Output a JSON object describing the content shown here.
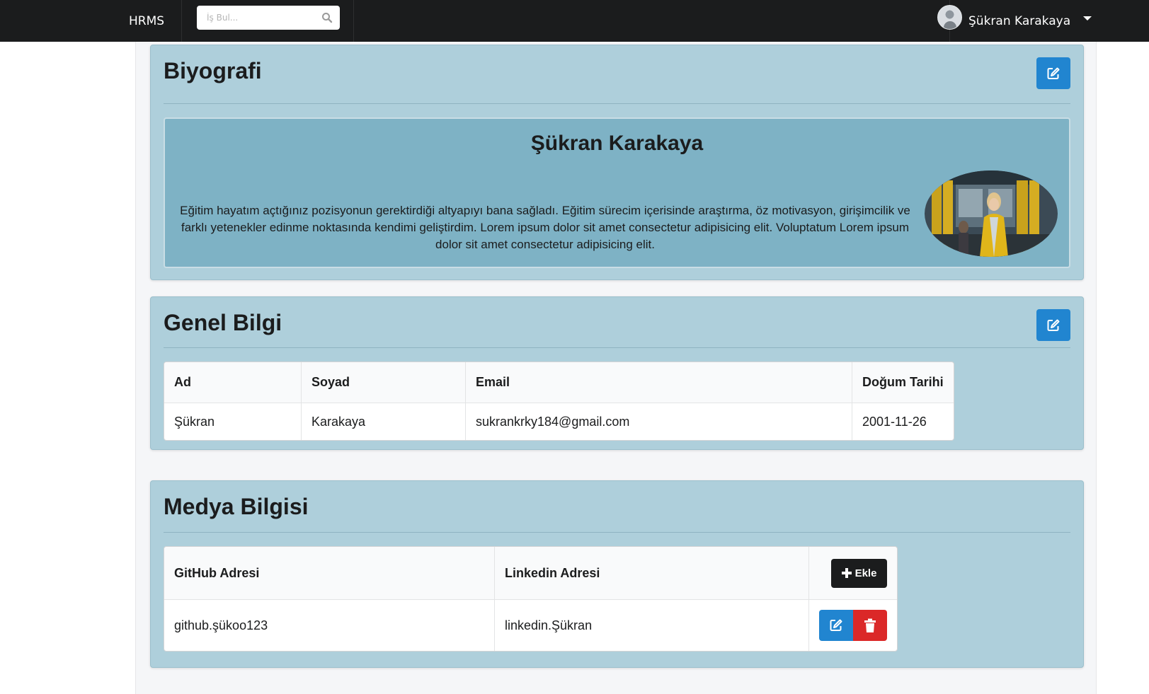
{
  "navbar": {
    "brand": "HRMS",
    "search_placeholder": "İş Bul...",
    "user_name": "Şükran Karakaya"
  },
  "biography": {
    "title": "Biyografi",
    "name": "Şükran Karakaya",
    "text": "Eğitim hayatım açtığınız pozisyonun gerektirdiği altyapıyı bana sağladı. Eğitim sürecim içerisinde araştırma, öz motivasyon, girişimcilik ve farklı yetenekler edinme noktasında kendimi geliştirdim. Lorem ipsum dolor sit amet consectetur adipisicing elit. Voluptatum Lorem ipsum dolor sit amet consectetur adipisicing elit."
  },
  "general_info": {
    "title": "Genel Bilgi",
    "columns": [
      "Ad",
      "Soyad",
      "Email",
      "Doğum Tarihi"
    ],
    "row": [
      "Şükran",
      "Karakaya",
      "sukrankrky184@gmail.com",
      "2001-11-26"
    ]
  },
  "media_info": {
    "title": "Medya Bilgisi",
    "columns": [
      "GitHub Adresi",
      "Linkedin Adresi"
    ],
    "add_label": "Ekle",
    "row": [
      "github.şükoo123",
      "linkedin.Şükran"
    ]
  },
  "colors": {
    "navbar": "#1b1c1d",
    "card": "#aecfdb",
    "bio_box": "#7eb2c5",
    "primary": "#2185d0",
    "danger": "#db2828"
  },
  "icons": [
    "search-icon",
    "user-avatar",
    "chevron-down-icon",
    "edit-icon",
    "plus-icon",
    "trash-icon"
  ]
}
